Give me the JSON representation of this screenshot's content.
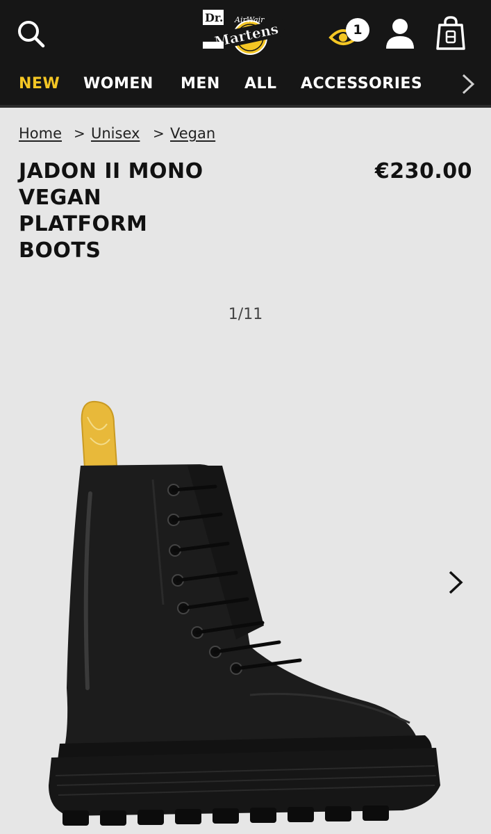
{
  "header": {
    "logo_text_top": "Dr.",
    "logo_text_main": "Martens",
    "logo_text_script": "AirWair",
    "icons": {
      "search": "search-icon",
      "recently_viewed": "eye-icon",
      "account": "user-icon",
      "bag": "shopping-bag-icon"
    },
    "recently_viewed_count": "1",
    "accent_color": "#f4c624"
  },
  "nav": {
    "items": [
      {
        "label": "NEW"
      },
      {
        "label": "WOMEN"
      },
      {
        "label": "MEN"
      },
      {
        "label": "ALL"
      },
      {
        "label": "ACCESSORIES"
      }
    ],
    "more_icon": "chevron-right-icon"
  },
  "breadcrumb": {
    "items": [
      {
        "label": "Home"
      },
      {
        "label": "Unisex"
      },
      {
        "label": "Vegan"
      }
    ],
    "separator": ">"
  },
  "product": {
    "title_lines": [
      "JADON II MONO",
      "VEGAN",
      "PLATFORM",
      "BOOTS"
    ],
    "price": "€230.00"
  },
  "gallery": {
    "counter": "1/11",
    "next_icon": "chevron-right-icon"
  }
}
